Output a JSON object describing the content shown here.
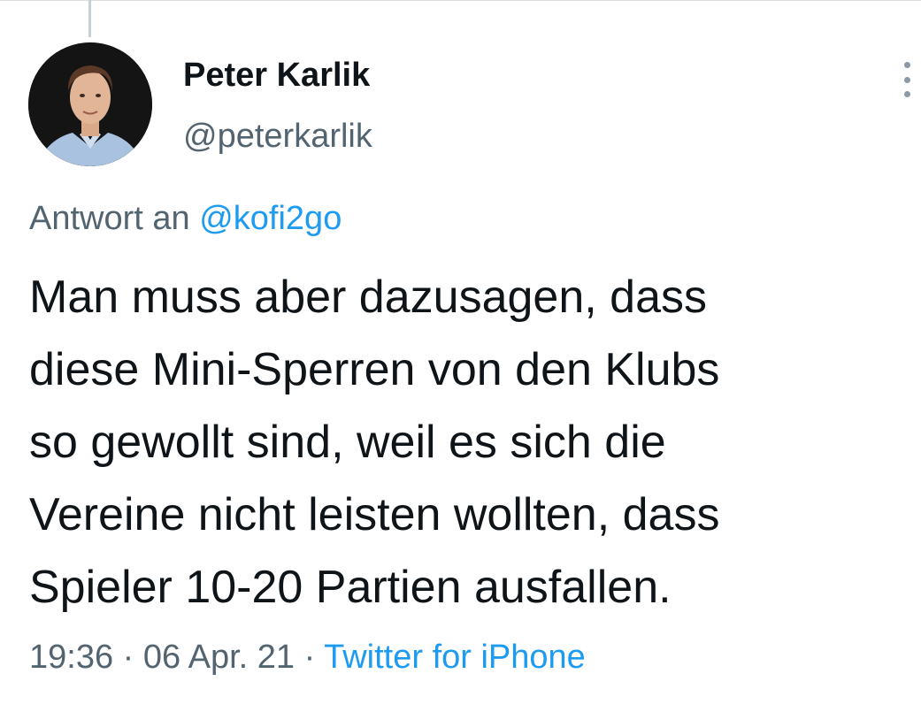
{
  "tweet": {
    "author": {
      "display_name": "Peter Karlik",
      "handle": "@peterkarlik"
    },
    "reply_to": {
      "prefix": "Antwort an",
      "mention": "@kofi2go"
    },
    "text_lines": [
      "Man muss aber dazusagen, dass",
      "diese Mini-Sperren von den Klubs",
      "so gewollt sind, weil es sich die",
      "Vereine nicht leisten wollten, dass",
      "Spieler 10-20 Partien ausfallen."
    ],
    "meta": {
      "time": "19:36",
      "separator": "·",
      "date": "06 Apr. 21",
      "source": "Twitter for iPhone"
    }
  },
  "icons": {
    "more": "more-vertical-icon",
    "avatar": "avatar-photo"
  },
  "colors": {
    "text_primary": "#0f1419",
    "text_secondary": "#536471",
    "link": "#1d9bf0",
    "thread_line": "#c4cfd6"
  }
}
